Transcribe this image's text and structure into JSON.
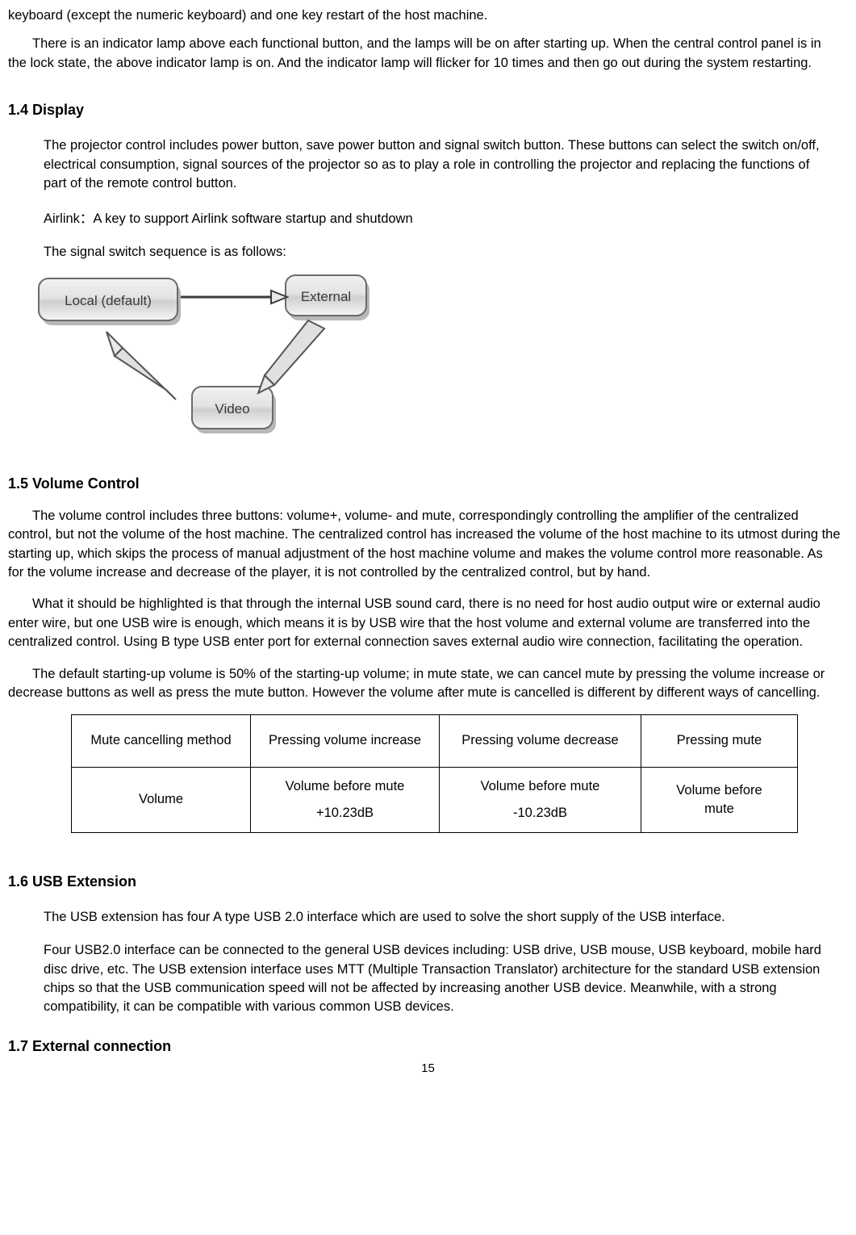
{
  "doc": {
    "page_number": "15",
    "paragraphs": {
      "top_line": "keyboard (except the numeric keyboard) and one key restart of the host machine.",
      "indicator_lamp": "There is an indicator lamp above each functional button, and the lamps will be on after starting up. When the central control panel is in the lock state, the above indicator lamp is on. And the indicator lamp will flicker for 10 times and then go out during the system restarting."
    },
    "sections": [
      {
        "heading": "1.4 Display",
        "paragraphs": [
          "The projector control includes power button, save power button and signal switch button. These buttons can select the switch on/off, electrical consumption, signal sources of the projector so as to play a role in controlling the projector and replacing the functions of part of the remote control button.",
          "Airlink：A key to support Airlink software startup and shutdown",
          "The signal switch sequence is as follows:"
        ]
      },
      {
        "heading": "1.5 Volume Control",
        "paragraphs": [
          "The volume control includes three buttons: volume+, volume- and mute, correspondingly controlling the amplifier of the centralized control, but not the volume of the host machine. The centralized control has increased the volume of the host machine to its utmost during the starting up, which skips the process of manual adjustment of the host machine volume and makes the volume control more reasonable. As for the volume increase and decrease of the player, it is not controlled by the centralized control, but by hand.",
          "What it should be highlighted is that through the internal USB sound card, there is no need for host audio output wire or external audio enter wire, but one USB wire is enough, which means it is by USB wire that the host volume and external volume are transferred into the centralized control. Using B type USB enter port for external connection saves external audio wire connection, facilitating the operation.",
          "The default starting-up volume is 50% of the starting-up volume; in mute state, we can cancel mute by pressing the volume increase or decrease buttons as well as press the mute button. However the volume after mute is cancelled is different by different ways of cancelling."
        ]
      },
      {
        "heading": "1.6 USB Extension",
        "paragraphs": [
          "The USB extension has four A type USB 2.0 interface which are used to solve the short supply of the USB interface.",
          "Four USB2.0 interface can be connected to the general USB devices including:    USB drive, USB mouse, USB keyboard, mobile hard disc drive, etc. The USB extension interface uses MTT (Multiple Transaction Translator) architecture for the standard USB extension chips so that the USB communication speed will not be affected by increasing another USB device. Meanwhile, with a strong compatibility, it can be compatible with various common USB devices."
        ]
      },
      {
        "heading": "1.7 External connection",
        "paragraphs": []
      }
    ],
    "diagram": {
      "nodes": [
        {
          "label": "Local (default)"
        },
        {
          "label": "External"
        },
        {
          "label": "Video"
        }
      ]
    },
    "table": {
      "header": [
        "Mute cancelling method",
        "Pressing volume increase",
        "Pressing volume decrease",
        "Pressing mute"
      ],
      "rows": [
        {
          "label": "Volume",
          "cells": [
            {
              "line1": "Volume before mute",
              "line2": "+10.23dB"
            },
            {
              "line1": "Volume before mute",
              "line2": "-10.23dB"
            },
            {
              "line1": "Volume before",
              "line2": "mute"
            }
          ]
        }
      ]
    }
  }
}
